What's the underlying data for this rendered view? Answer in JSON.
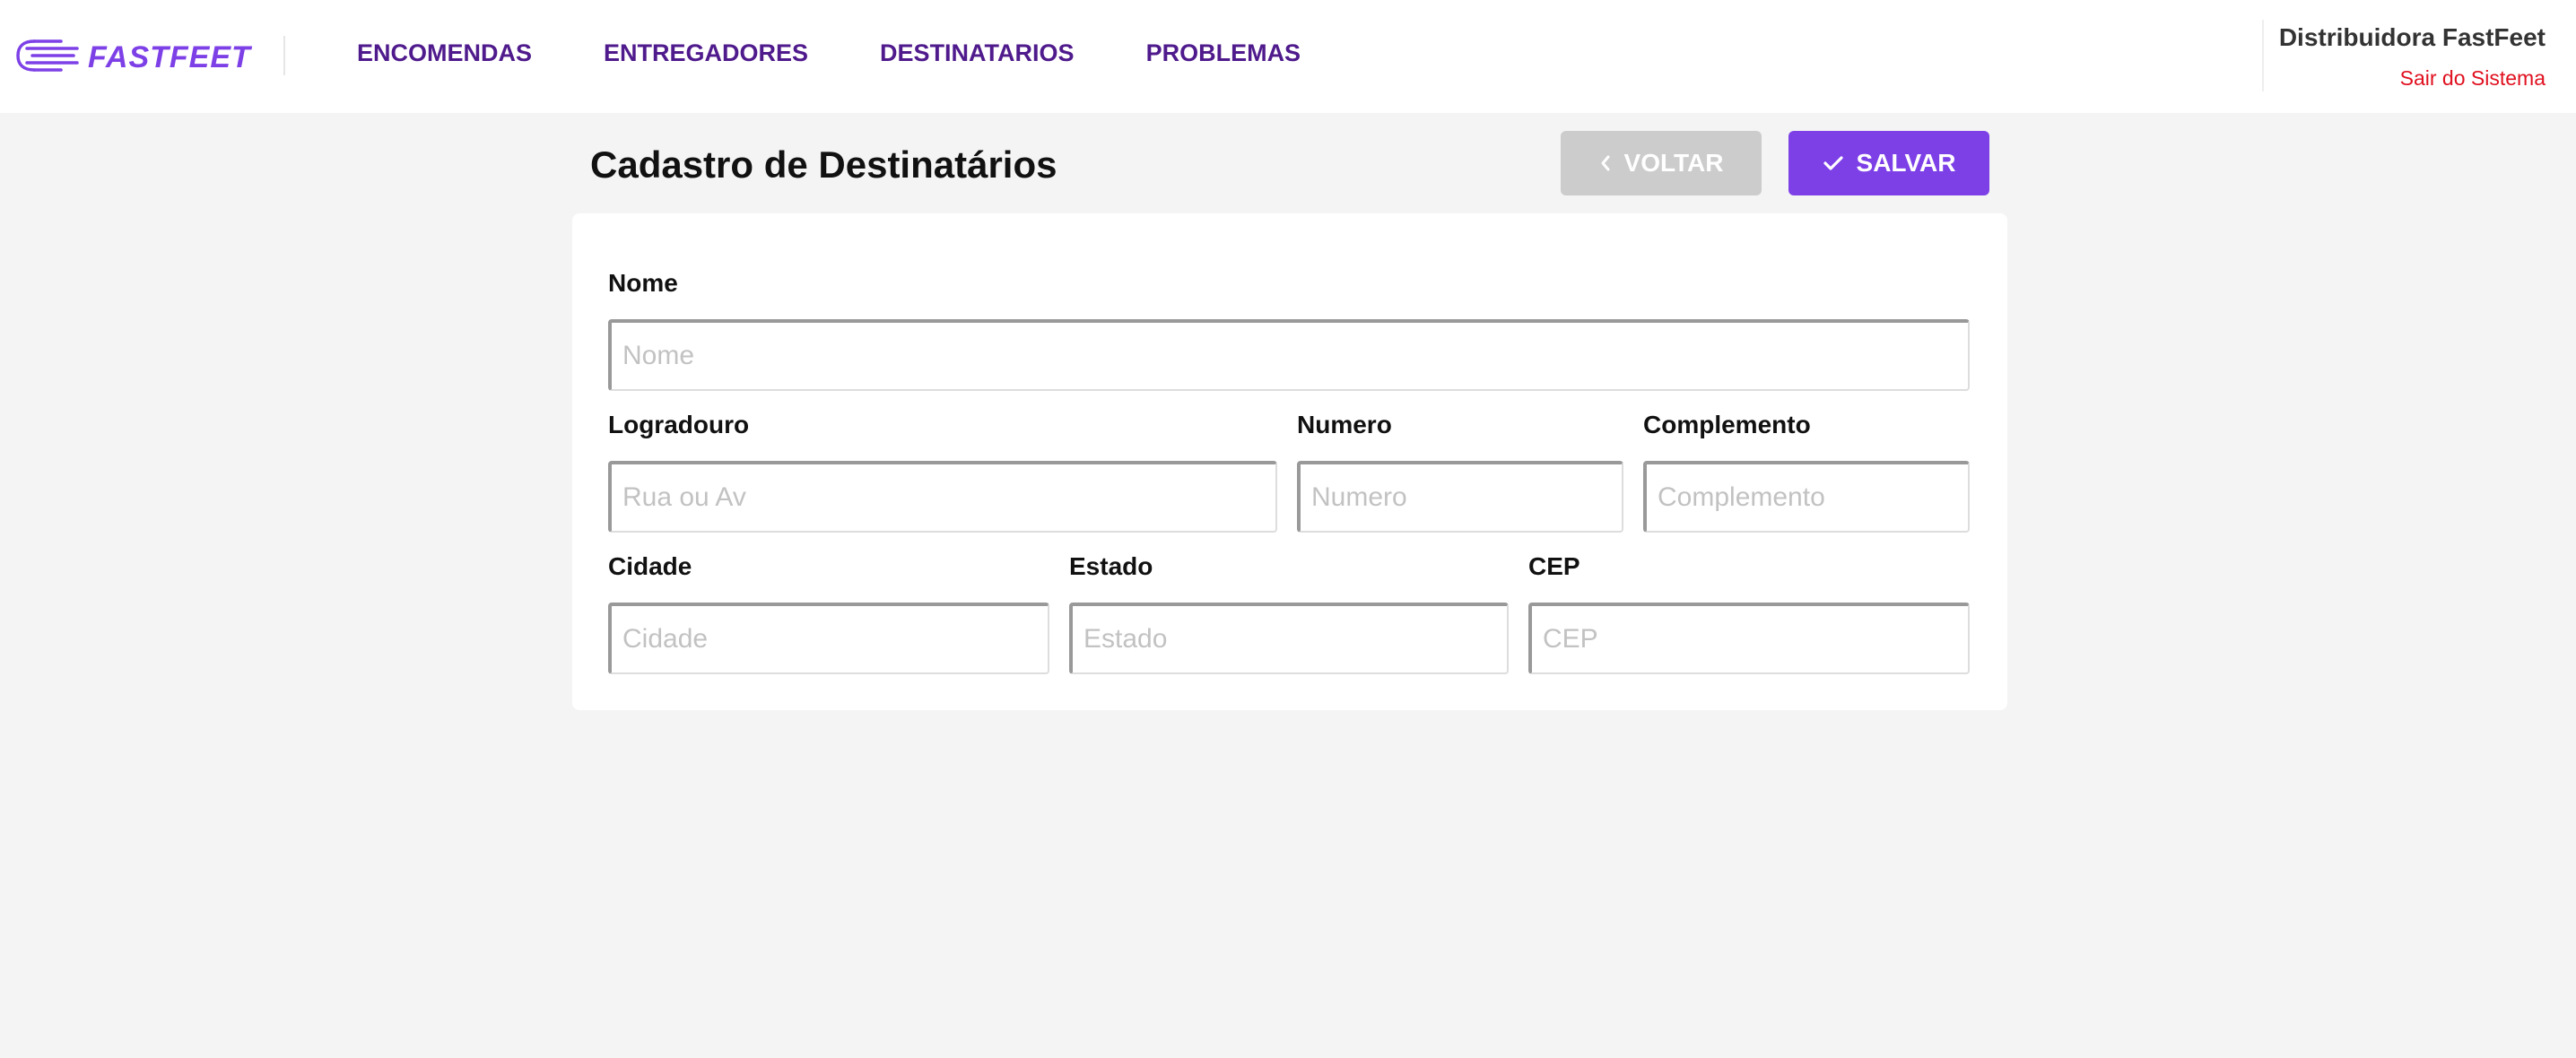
{
  "header": {
    "logo_text": "FASTFEET",
    "logo_icon": "fast-truck-icon",
    "nav": [
      {
        "label": "ENCOMENDAS"
      },
      {
        "label": "ENTREGADORES"
      },
      {
        "label": "DESTINATARIOS"
      },
      {
        "label": "PROBLEMAS"
      }
    ],
    "user_name": "Distribuidora FastFeet",
    "logout_label": "Sair do Sistema"
  },
  "page": {
    "title": "Cadastro de Destinatários",
    "back_label": "VOLTAR",
    "save_label": "SALVAR"
  },
  "form": {
    "nome": {
      "label": "Nome",
      "placeholder": "Nome",
      "value": ""
    },
    "logradouro": {
      "label": "Logradouro",
      "placeholder": "Rua ou Av",
      "value": ""
    },
    "numero": {
      "label": "Numero",
      "placeholder": "Numero",
      "value": ""
    },
    "complemento": {
      "label": "Complemento",
      "placeholder": "Complemento",
      "value": ""
    },
    "cidade": {
      "label": "Cidade",
      "placeholder": "Cidade",
      "value": ""
    },
    "estado": {
      "label": "Estado",
      "placeholder": "Estado",
      "value": ""
    },
    "cep": {
      "label": "CEP",
      "placeholder": "CEP",
      "value": ""
    }
  },
  "colors": {
    "brand": "#7d40e7",
    "nav_text": "#4f1a8c",
    "logout": "#e0101f",
    "back_button": "#cccccc",
    "background": "#f4f4f4"
  }
}
